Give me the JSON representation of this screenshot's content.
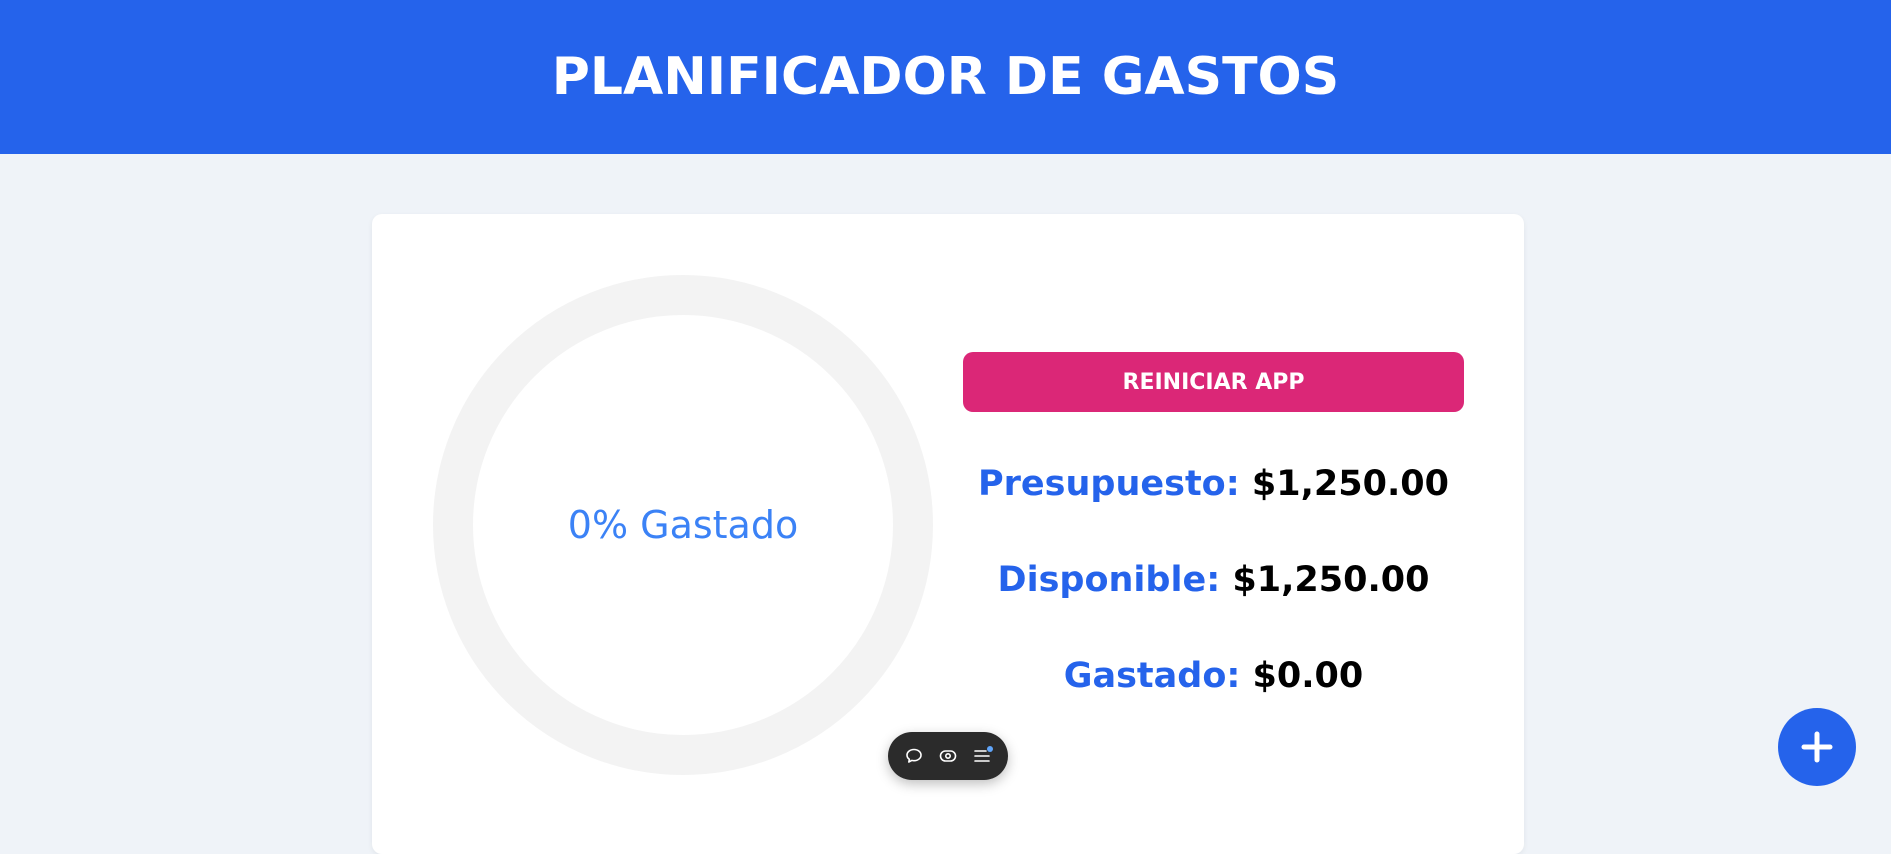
{
  "header": {
    "title": "PLANIFICADOR DE GASTOS"
  },
  "progress": {
    "label": "0% Gastado",
    "percent_spent": 0
  },
  "actions": {
    "reset_label": "REINICIAR APP"
  },
  "summary": {
    "budget_label": "Presupuesto:",
    "budget_value": "$1,250.00",
    "available_label": "Disponible:",
    "available_value": "$1,250.00",
    "spent_label": "Gastado:",
    "spent_value": "$0.00"
  },
  "toolbar": {
    "icons": [
      "comment-icon",
      "eye-icon",
      "menu-icon"
    ]
  },
  "fab": {
    "icon": "plus-icon"
  },
  "colors": {
    "primary": "#2563eb",
    "accent": "#db2777",
    "ring_track": "#f3f3f3",
    "ring_progress": "#3b82f6",
    "background": "#eff3f8"
  }
}
